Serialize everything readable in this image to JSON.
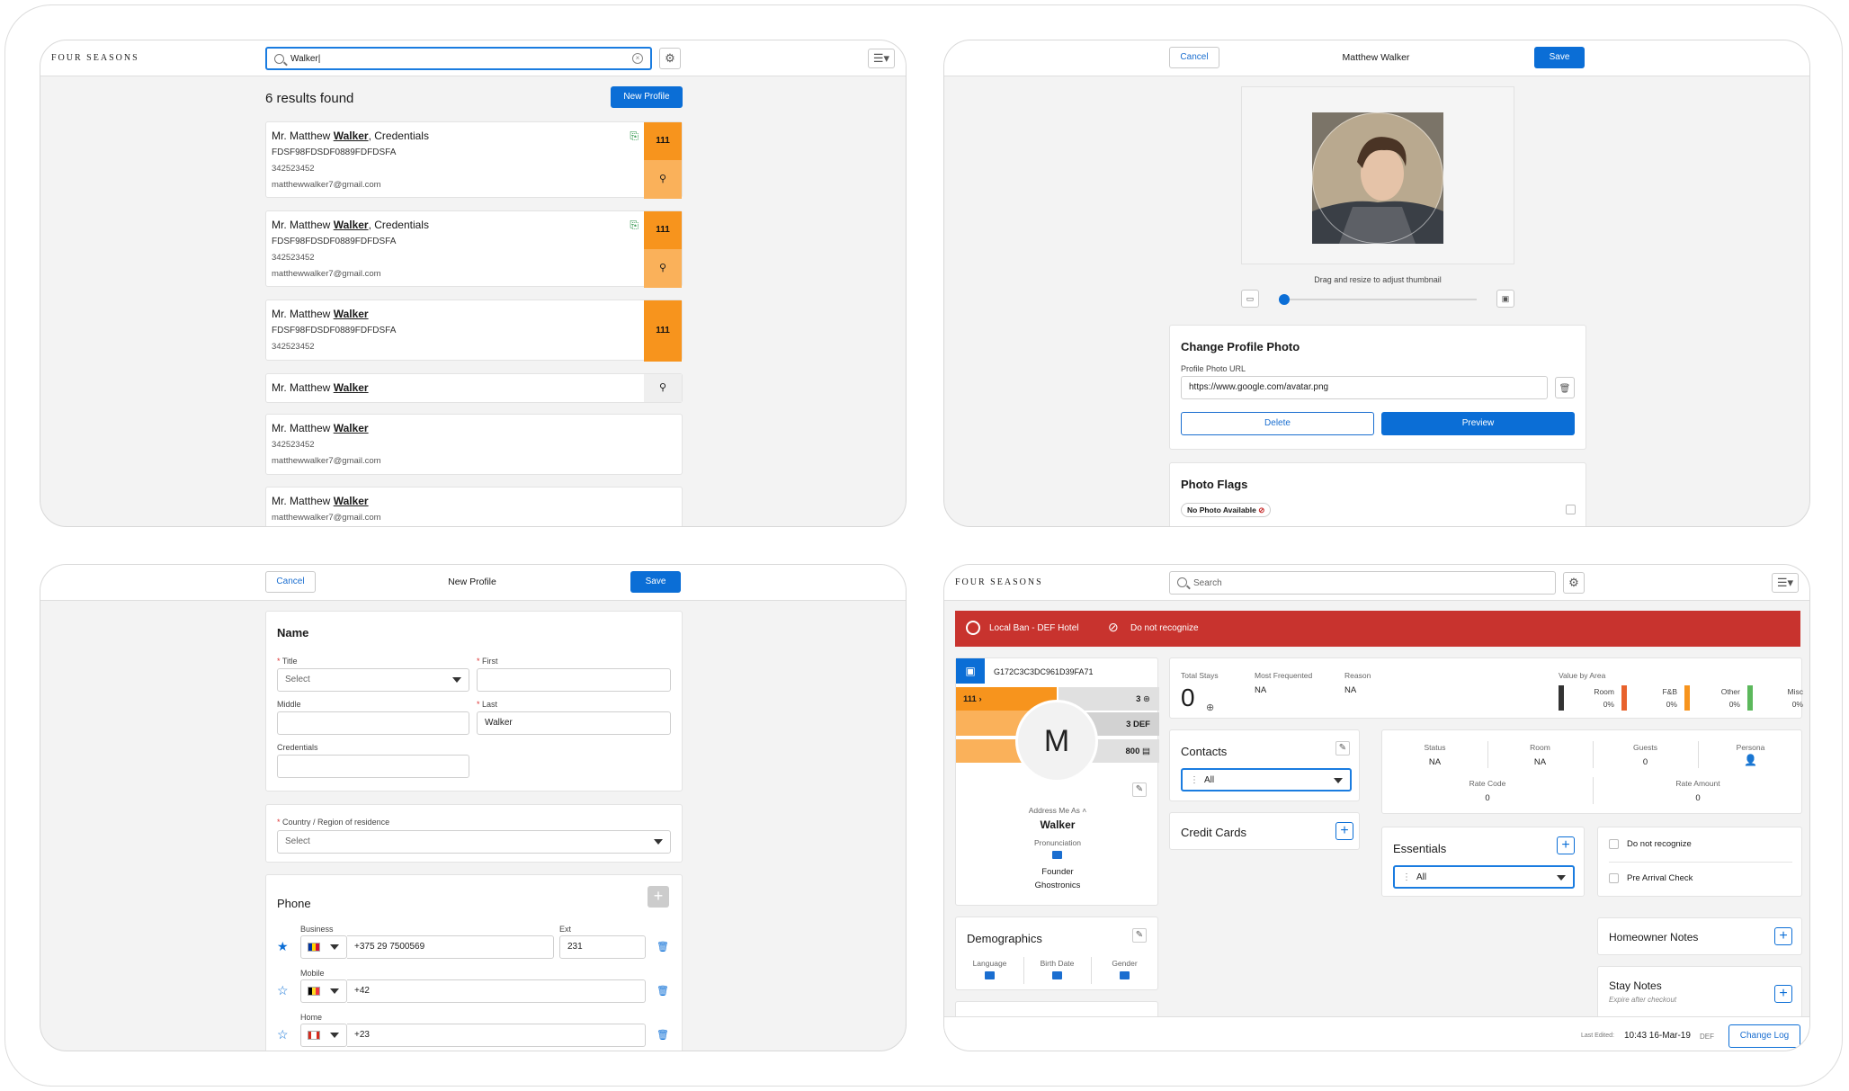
{
  "p1": {
    "brand": "FOUR SEASONS",
    "search_value": "Walker|",
    "results_count": "6 results found",
    "new_profile": "New Profile",
    "results": [
      {
        "prefix": "Mr. Matthew ",
        "bold": "Walker",
        "suffix": ", Credentials",
        "code": "FDSF98FDSDF0889FDFDSFA",
        "phone": "342523452",
        "email": "matthewwalker7@gmail.com",
        "room": "111"
      },
      {
        "prefix": "Mr. Matthew ",
        "bold": "Walker",
        "suffix": ", Credentials",
        "code": "FDSF98FDSDF0889FDFDSFA",
        "phone": "342523452",
        "email": "matthewwalker7@gmail.com",
        "room": "111"
      },
      {
        "prefix": "Mr. Matthew ",
        "bold": "Walker",
        "suffix": "",
        "code": "FDSF98FDSDF0889FDFDSFA",
        "phone": "342523452",
        "room": "111"
      },
      {
        "prefix": "Mr. Matthew ",
        "bold": "Walker",
        "suffix": ""
      },
      {
        "prefix": "Mr. Matthew ",
        "bold": "Walker",
        "suffix": "",
        "phone": "342523452",
        "email": "matthewwalker7@gmail.com"
      },
      {
        "prefix": "Mr. Matthew ",
        "bold": "Walker",
        "suffix": "",
        "email": "matthewwalker7@gmail.com"
      }
    ]
  },
  "p2": {
    "cancel": "Cancel",
    "title": "Matthew Walker",
    "save": "Save",
    "drag_hint": "Drag and resize to adjust thumbnail",
    "zoom_value": 0.04,
    "change_photo_title": "Change Profile Photo",
    "url_label": "Profile Photo URL",
    "url_value": "https://www.google.com/avatar.png",
    "delete": "Delete",
    "preview": "Preview",
    "flags_title": "Photo Flags",
    "flag_badge": "No Photo Available"
  },
  "p3": {
    "cancel": "Cancel",
    "title": "New Profile",
    "save": "Save",
    "name_title": "Name",
    "title_label": "Title",
    "title_ph": "Select",
    "first_label": "First",
    "middle_label": "Middle",
    "last_label": "Last",
    "last_value": "Walker",
    "cred_label": "Credentials",
    "country_label": "Country / Region of residence",
    "country_ph": "Select",
    "phone_title": "Phone",
    "business_label": "Business",
    "ext_label": "Ext",
    "business_value": "+375 29 7500569",
    "ext_value": "231",
    "mobile_label": "Mobile",
    "mobile_value": "+42",
    "home_label": "Home",
    "home_value": "+23"
  },
  "p4": {
    "brand": "FOUR SEASONS",
    "search_ph": "Search",
    "alert_ban": "Local Ban - DEF Hotel",
    "alert_dnr": "Do not recognize",
    "profile_id": "G172C3C3DC961D39FA71",
    "room": "111",
    "stat1": "3",
    "stat2": "3 DEF",
    "stat3": "800",
    "avatar_letter": "M",
    "address_as_label": "Address Me As",
    "address_as": "Walker",
    "pronunciation": "Pronunciation",
    "role": "Founder",
    "company": "Ghostronics",
    "demographics": "Demographics",
    "language": "Language",
    "birth_date": "Birth Date",
    "gender": "Gender",
    "total_stays_label": "Total Stays",
    "total_stays": "0",
    "most_freq_label": "Most Frequented",
    "most_freq": "NA",
    "reason_label": "Reason",
    "reason": "NA",
    "value_by_area": "Value by Area",
    "areas": [
      {
        "name": "Room",
        "pct": "0%",
        "color": "#333333"
      },
      {
        "name": "F&B",
        "pct": "0%",
        "color": "#e8622c"
      },
      {
        "name": "Other",
        "pct": "0%",
        "color": "#f7941d"
      },
      {
        "name": "Misc",
        "pct": "0%",
        "color": "#5cb85c"
      }
    ],
    "contacts": "Contacts",
    "contacts_filter": "All",
    "credit_cards": "Credit Cards",
    "status_label": "Status",
    "status": "NA",
    "room_label": "Room",
    "room_val": "NA",
    "guests_label": "Guests",
    "guests": "0",
    "persona_label": "Persona",
    "rate_code_label": "Rate Code",
    "rate_code": "0",
    "rate_amount_label": "Rate Amount",
    "rate_amount": "0",
    "essentials": "Essentials",
    "essentials_filter": "All",
    "dnr_check": "Do not recognize",
    "pre_arrival": "Pre Arrival Check",
    "homeowner_notes": "Homeowner Notes",
    "stay_notes": "Stay Notes",
    "stay_notes_sub": "Expire after checkout",
    "last_edited_label": "Last Edited:",
    "last_edited": "10:43 16-Mar-19",
    "last_edited_by": "DEF",
    "change_log": "Change Log"
  }
}
